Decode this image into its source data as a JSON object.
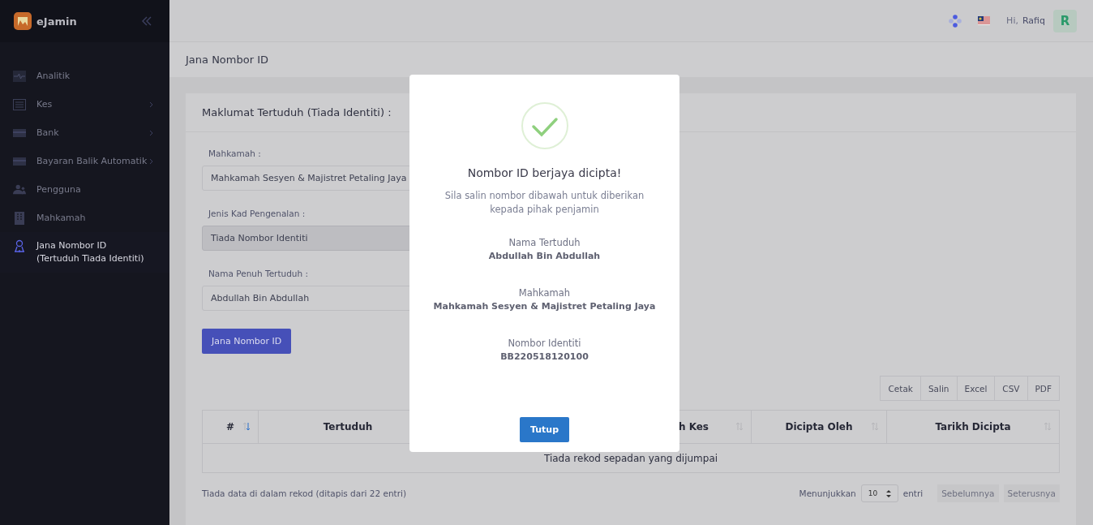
{
  "sidebar": {
    "logo": "eJamin",
    "items": [
      {
        "label": "Analitik",
        "has_submenu": false,
        "selected": false
      },
      {
        "label": "Kes",
        "has_submenu": true,
        "selected": false
      },
      {
        "label": "Bank",
        "has_submenu": true,
        "selected": false
      },
      {
        "label": "Bayaran Balik Automatik",
        "has_submenu": true,
        "selected": false
      },
      {
        "label": "Pengguna",
        "has_submenu": false,
        "selected": false
      },
      {
        "label": "Mahkamah",
        "has_submenu": false,
        "selected": false
      },
      {
        "label": "Jana Nombor ID",
        "sublabel": "(Tertuduh Tiada Identiti)",
        "has_submenu": false,
        "selected": true
      }
    ]
  },
  "topbar": {
    "greeting": "Hi,",
    "user": "Rafiq",
    "avatar": "R"
  },
  "page_title": "Jana Nombor ID",
  "card": {
    "title": "Maklumat Tertuduh (Tiada Identiti) :",
    "fields": [
      {
        "label": "Mahkamah :",
        "value": "Mahkamah Sesyen & Majistret Petaling Jaya",
        "disabled": false
      },
      {
        "label": "Jenis Kad Pengenalan :",
        "value": "Tiada Nombor Identiti",
        "disabled": true
      },
      {
        "label": "Nama Penuh Tertuduh :",
        "value": "Abdullah Bin Abdullah",
        "disabled": false
      }
    ],
    "submit": "Jana Nombor ID",
    "export_buttons": [
      "Cetak",
      "Salin",
      "Excel",
      "CSV",
      "PDF"
    ],
    "table": {
      "columns": [
        {
          "label": "#",
          "sorted": true
        },
        {
          "label": "Tertuduh"
        },
        {},
        {
          "label": "h Kes",
          "sorted": false
        },
        {
          "label": "Dicipta Oleh",
          "sorted": false
        },
        {
          "label": "Tarikh Dicipta",
          "sorted": false
        }
      ],
      "empty": "Tiada rekod sepadan yang dijumpai"
    },
    "info": "Tiada data di dalam rekod (ditapis dari 22 entri)",
    "length": {
      "before": "Menunjukkan",
      "value": "10",
      "after": "entri"
    },
    "pagination": [
      {
        "label": "Sebelumnya",
        "disabled": true
      },
      {
        "label": "Seterusnya",
        "disabled": true
      }
    ]
  },
  "modal": {
    "title": "Nombor ID berjaya dicipta!",
    "message": "Sila salin nombor dibawah untuk diberikan kepada pihak penjamin",
    "details": [
      {
        "label": "Nama Tertuduh",
        "value": "Abdullah Bin Abdullah"
      },
      {
        "label": "Mahkamah",
        "value": "Mahkamah Sesyen & Majistret Petaling Jaya"
      },
      {
        "label": "Nombor Identiti",
        "value": "BB220518120100"
      }
    ],
    "button": "Tutup"
  }
}
